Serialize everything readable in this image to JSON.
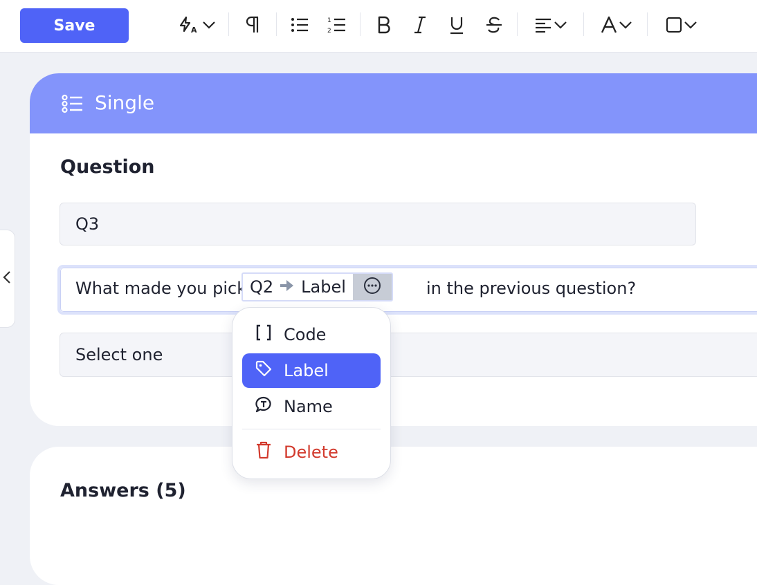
{
  "toolbar": {
    "save_label": "Save"
  },
  "block": {
    "type_label": "Single"
  },
  "question": {
    "section_label": "Question",
    "code_value": "Q3",
    "text_before": "What made you pick",
    "pipe_code": "Q2",
    "pipe_field": "Label",
    "text_after": "in the previous question?",
    "select_placeholder": "Select one"
  },
  "pipe_menu": {
    "items": [
      {
        "label": "Code",
        "icon": "brackets-icon",
        "selected": false
      },
      {
        "label": "Label",
        "icon": "tag-icon",
        "selected": true
      },
      {
        "label": "Name",
        "icon": "text-bubble-icon",
        "selected": false
      }
    ],
    "delete_label": "Delete"
  },
  "answers": {
    "title": "Answers (5)"
  },
  "colors": {
    "accent": "#4f63f7",
    "header": "#8394fb",
    "danger": "#d23a2d"
  }
}
